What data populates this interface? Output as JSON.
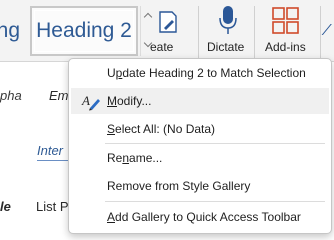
{
  "ribbon": {
    "style_gallery": {
      "partial_tile": "ng",
      "selected_tile": "Heading 2"
    },
    "buttons": {
      "create_label": "eate",
      "dictate_label": "Dictate",
      "addins_label": "Add-ins"
    }
  },
  "document": {
    "style_samples": {
      "alpha_fragment": "pha",
      "emphasis_fragment": "Em",
      "intense_fragment": "Inter",
      "title_fragment": "le",
      "list_fragment": "List P"
    }
  },
  "context_menu": {
    "items": [
      {
        "label": "Update Heading 2 to Match Selection",
        "accesskey": "p"
      },
      {
        "label": "Modify...",
        "icon": "style-pencil-icon",
        "accesskey": "M",
        "hovered": true
      },
      {
        "label": "Select All: (No Data)",
        "accesskey": "S"
      },
      {
        "label": "Rename...",
        "accesskey": "n"
      },
      {
        "label": "Remove from Style Gallery"
      },
      {
        "label": "Add Gallery to Quick Access Toolbar",
        "accesskey": "A"
      }
    ]
  },
  "colors": {
    "heading_blue": "#2e5a94",
    "ribbon_bg": "#f3f3f3",
    "menu_hover": "#f0f0f0",
    "addins_icon_red": "#d04a2b"
  }
}
